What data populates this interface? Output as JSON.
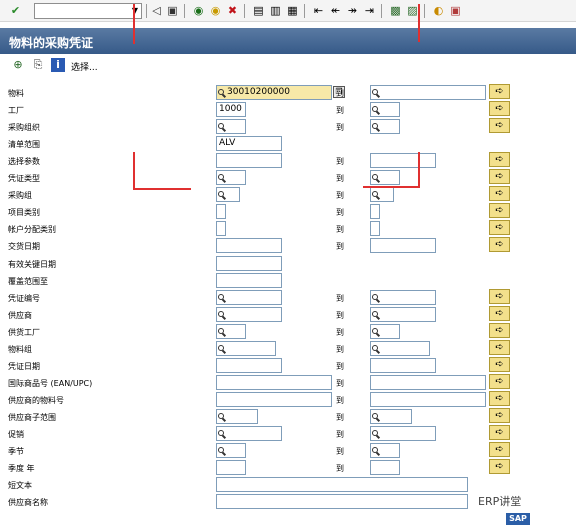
{
  "toolbar": {
    "enter": "✔",
    "back": "◁",
    "save": "▣",
    "nav1": "◉",
    "nav2": "◉",
    "cancel": "✖",
    "icons": [
      "print-icon",
      "find-icon",
      "find-next-icon",
      "first-page-icon",
      "prev-page-icon",
      "next-page-icon",
      "last-page-icon",
      "create-session-icon",
      "shortcut-icon",
      "help-icon",
      "layout-icon"
    ]
  },
  "title": "物料的采购凭证",
  "app_toolbar": {
    "select_label": "选择..."
  },
  "to_label": "到",
  "rows": [
    {
      "label": "物料",
      "low": "30010200000",
      "high": ""
    },
    {
      "label": "工厂",
      "low": "1000",
      "high": ""
    },
    {
      "label": "采购组织",
      "low": "",
      "high": ""
    },
    {
      "label": "清单范围",
      "low": "ALV",
      "high": ""
    },
    {
      "label": "选择参数",
      "low": "",
      "high": ""
    },
    {
      "label": "凭证类型",
      "low": "",
      "high": ""
    },
    {
      "label": "采购组",
      "low": "",
      "high": ""
    },
    {
      "label": "项目类别",
      "low": "",
      "high": ""
    },
    {
      "label": "帐户分配类别",
      "low": "",
      "high": ""
    },
    {
      "label": "交货日期",
      "low": "",
      "high": ""
    },
    {
      "label": "有效关键日期",
      "low": "",
      "high": ""
    },
    {
      "label": "覆盖范围至",
      "low": "",
      "high": ""
    },
    {
      "label": "凭证编号",
      "low": "",
      "high": ""
    },
    {
      "label": "供应商",
      "low": "",
      "high": ""
    },
    {
      "label": "供货工厂",
      "low": "",
      "high": ""
    },
    {
      "label": "物料组",
      "low": "",
      "high": ""
    },
    {
      "label": "凭证日期",
      "low": "",
      "high": ""
    },
    {
      "label": "国际商品号 (EAN/UPC)",
      "low": "",
      "high": ""
    },
    {
      "label": "供应商的物料号",
      "low": "",
      "high": ""
    },
    {
      "label": "供应商子范围",
      "low": "",
      "high": ""
    },
    {
      "label": "促销",
      "low": "",
      "high": ""
    },
    {
      "label": "季节",
      "low": "",
      "high": ""
    },
    {
      "label": "季度 年",
      "low": "",
      "high": ""
    },
    {
      "label": "短文本",
      "low": "",
      "high": ""
    },
    {
      "label": "供应商名称",
      "low": "",
      "high": ""
    }
  ],
  "watermark": "ERP讲堂",
  "sap_logo": "SAP"
}
